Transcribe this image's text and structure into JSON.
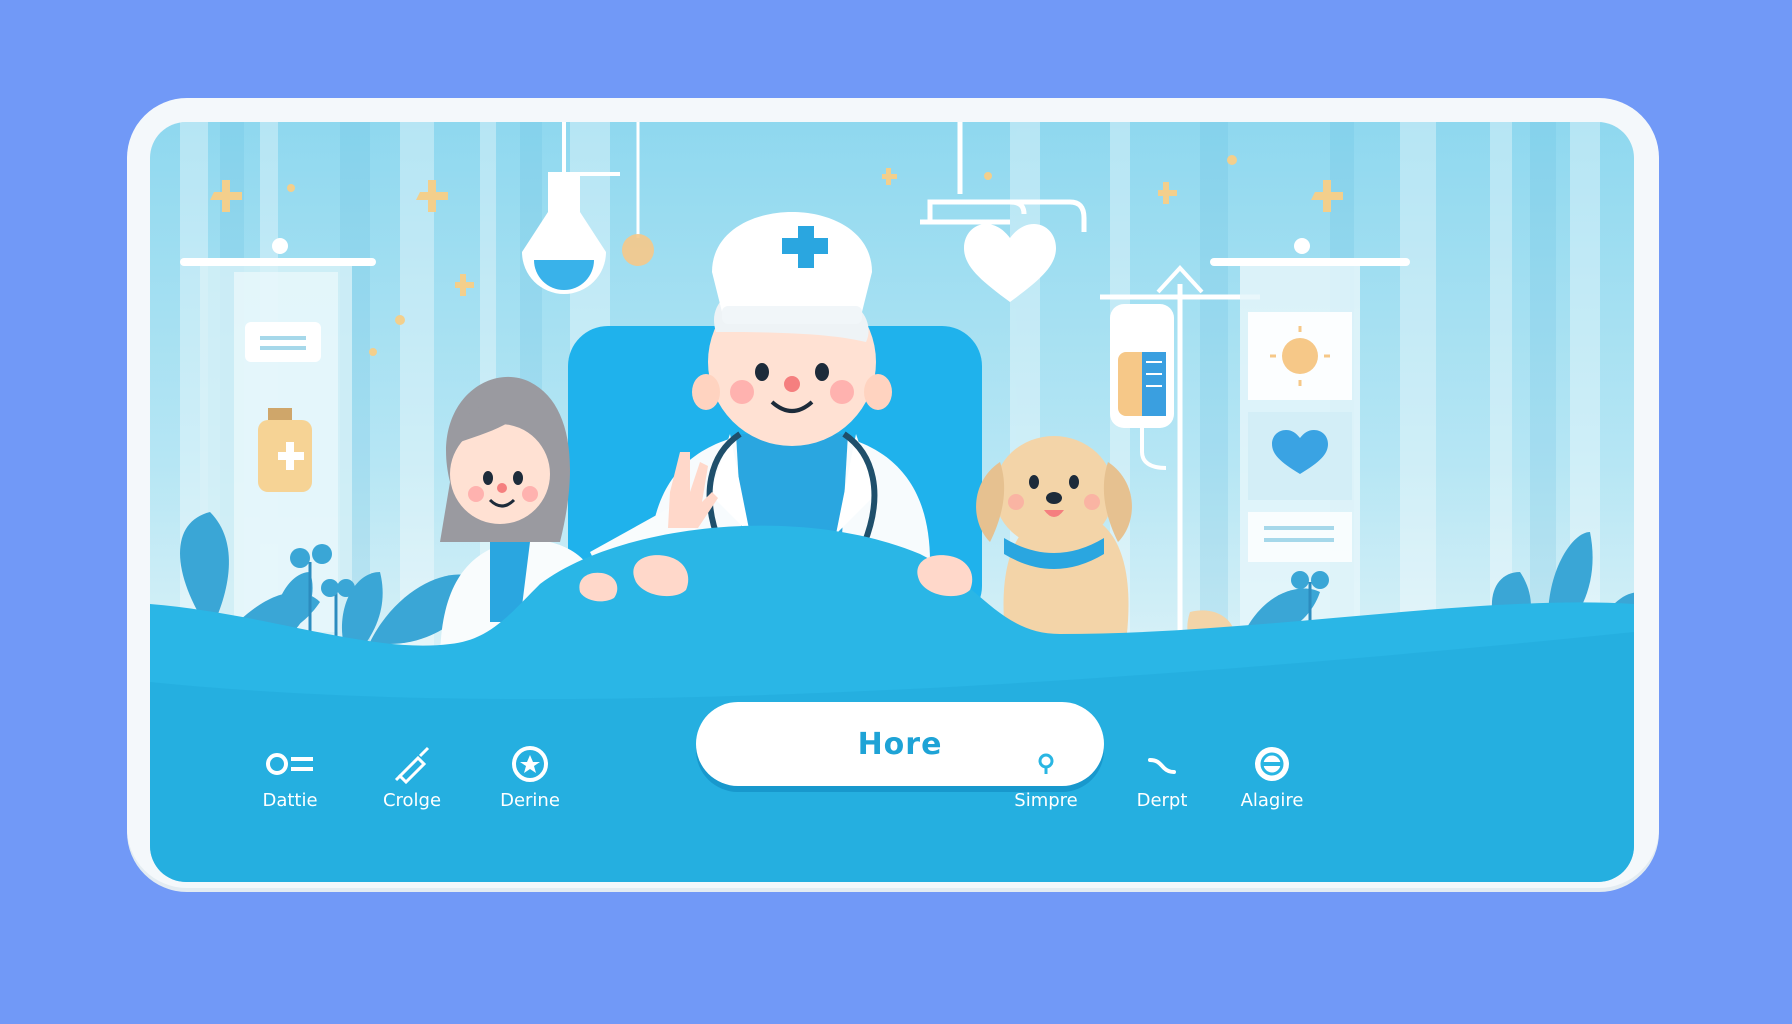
{
  "nav": {
    "items": [
      {
        "label": "Dattie",
        "icon": "toggle-icon"
      },
      {
        "label": "Crolge",
        "icon": "syringe-icon"
      },
      {
        "label": "Derine",
        "icon": "star-circle-icon"
      },
      {
        "label": "Simpre",
        "icon": "location-pin-icon"
      },
      {
        "label": "Derpt",
        "icon": "curve-icon"
      },
      {
        "label": "Alagire",
        "icon": "plus-circle-icon"
      }
    ],
    "home_label": "Hore"
  },
  "colors": {
    "background": "#7199f7",
    "accent": "#1ea3d6",
    "bar": "#29b6e3",
    "bed": "#21b4ea",
    "dog": "#f3d4a8"
  }
}
